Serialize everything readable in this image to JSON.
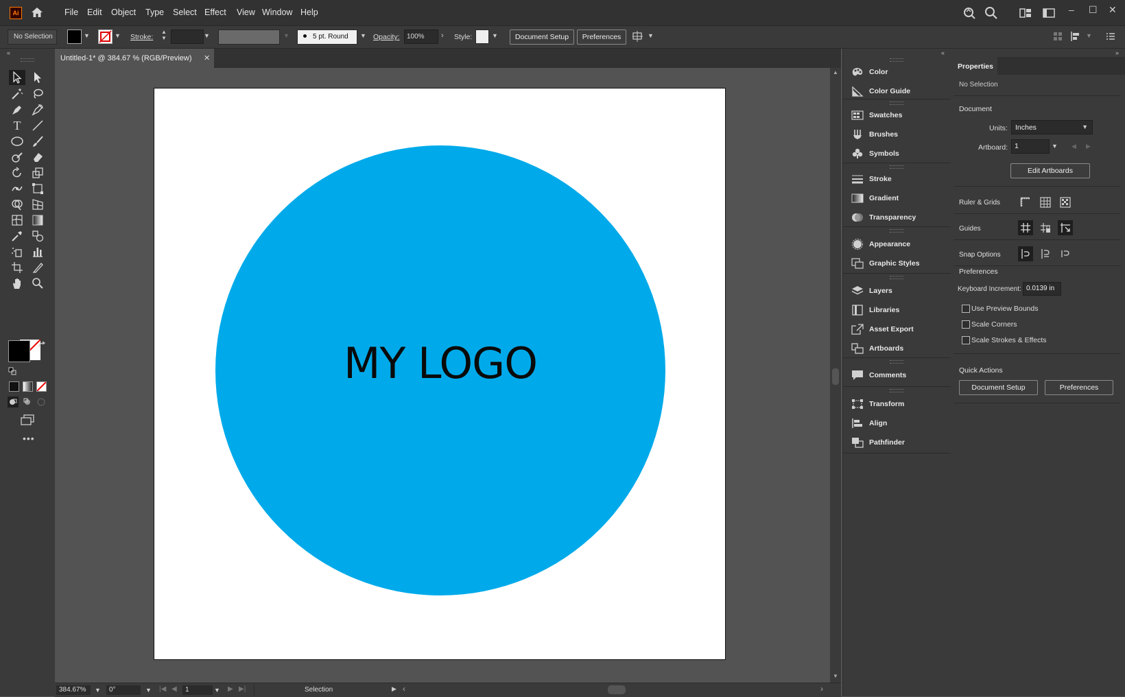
{
  "app": {
    "logo_text": "Ai"
  },
  "menu": [
    "File",
    "Edit",
    "Object",
    "Type",
    "Select",
    "Effect",
    "View",
    "Window",
    "Help"
  ],
  "control_bar": {
    "selection_label": "No Selection",
    "stroke_label": "Stroke:",
    "brush_label": "5 pt. Round",
    "opacity_label": "Opacity:",
    "opacity_value": "100%",
    "style_label": "Style:",
    "document_setup": "Document Setup",
    "preferences": "Preferences"
  },
  "document": {
    "tab_title": "Untitled-1* @ 384.67 % (RGB/Preview)",
    "logo_text": "MY LOGO",
    "circle_color": "#00aaea"
  },
  "status_bar": {
    "zoom": "384.67%",
    "rotation": "0°",
    "artboard": "1",
    "tool": "Selection"
  },
  "panels": [
    {
      "label": "Color",
      "icon": "palette-icon"
    },
    {
      "label": "Color Guide",
      "icon": "color-guide-icon"
    },
    {
      "label": "Swatches",
      "icon": "swatches-icon"
    },
    {
      "label": "Brushes",
      "icon": "brushes-icon"
    },
    {
      "label": "Symbols",
      "icon": "symbols-icon"
    },
    {
      "label": "Stroke",
      "icon": "stroke-icon"
    },
    {
      "label": "Gradient",
      "icon": "gradient-icon"
    },
    {
      "label": "Transparency",
      "icon": "transparency-icon"
    },
    {
      "label": "Appearance",
      "icon": "appearance-icon"
    },
    {
      "label": "Graphic Styles",
      "icon": "graphic-styles-icon"
    },
    {
      "label": "Layers",
      "icon": "layers-icon"
    },
    {
      "label": "Libraries",
      "icon": "libraries-icon"
    },
    {
      "label": "Asset Export",
      "icon": "asset-export-icon"
    },
    {
      "label": "Artboards",
      "icon": "artboards-icon"
    },
    {
      "label": "Comments",
      "icon": "comments-icon"
    },
    {
      "label": "Transform",
      "icon": "transform-icon"
    },
    {
      "label": "Align",
      "icon": "align-icon"
    },
    {
      "label": "Pathfinder",
      "icon": "pathfinder-icon"
    }
  ],
  "properties": {
    "tab": "Properties",
    "selection": "No Selection",
    "document_title": "Document",
    "units_label": "Units:",
    "units_value": "Inches",
    "artboard_label": "Artboard:",
    "artboard_value": "1",
    "edit_artboards": "Edit Artboards",
    "ruler_grids": "Ruler & Grids",
    "guides": "Guides",
    "snap_options": "Snap Options",
    "preferences_title": "Preferences",
    "keyboard_increment_label": "Keyboard Increment:",
    "keyboard_increment_value": "0.0139 in",
    "use_preview_bounds": "Use Preview Bounds",
    "scale_corners": "Scale Corners",
    "scale_strokes": "Scale Strokes & Effects",
    "quick_actions": "Quick Actions",
    "document_setup": "Document Setup",
    "preferences_button": "Preferences"
  }
}
